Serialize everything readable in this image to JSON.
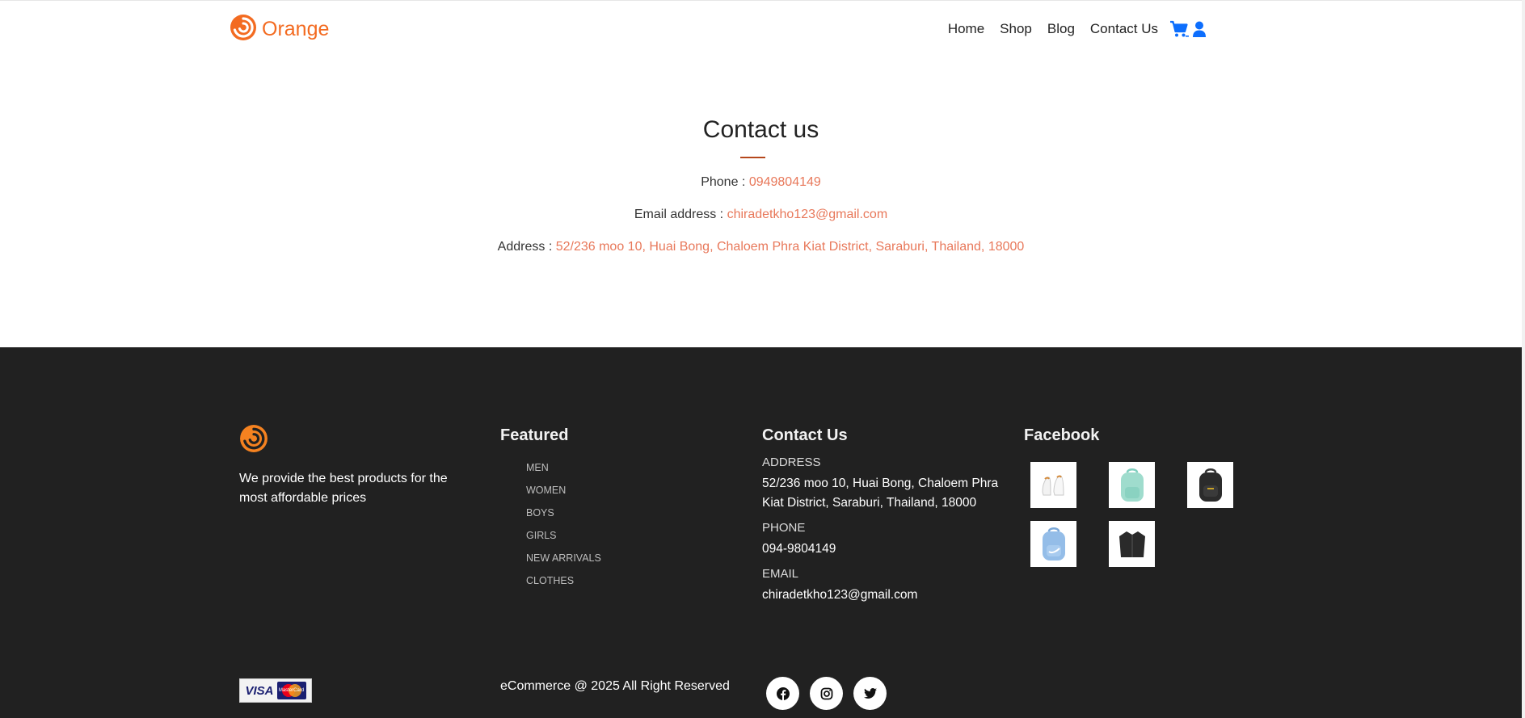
{
  "navbar": {
    "brand": "Orange",
    "links": [
      "Home",
      "Shop",
      "Blog",
      "Contact Us"
    ],
    "icons": [
      "cart-icon",
      "user-icon"
    ],
    "accent_color": "#f36b21",
    "icon_color": "#0d6efd"
  },
  "contact": {
    "title": "Contact us",
    "phone_label": "Phone :",
    "phone_value": "0949804149",
    "email_label": "Email address :",
    "email_value": "chiradetkho123@gmail.com",
    "address_label": "Address :",
    "address_value": "52/236 moo 10, Huai Bong, Chaloem Phra Kiat District, Saraburi, Thailand, 18000",
    "value_color": "#e8785a"
  },
  "footer": {
    "tagline": "We provide the best products for the most affordable prices",
    "featured": {
      "heading": "Featured",
      "items": [
        "MEN",
        "WOMEN",
        "BOYS",
        "GIRLS",
        "NEW ARRIVALS",
        "CLOTHES"
      ]
    },
    "contact_us": {
      "heading": "Contact Us",
      "address_label": "ADDRESS",
      "address_value": "52/236 moo 10, Huai Bong, Chaloem Phra Kiat District, Saraburi, Thailand, 18000",
      "phone_label": "PHONE",
      "phone_value": "094-9804149",
      "email_label": "EMAIL",
      "email_value": "chiradetkho123@gmail.com"
    },
    "facebook": {
      "heading": "Facebook",
      "thumbnails": [
        "white-sneakers",
        "mint-backpack",
        "black-backpack",
        "blue-backpack",
        "black-jacket"
      ]
    },
    "payment_badges": [
      "VISA",
      "MasterCard"
    ],
    "copyright": "eCommerce @ 2025 All Right Reserved",
    "socials": [
      "facebook-icon",
      "instagram-icon",
      "twitter-icon"
    ],
    "background": "#212121"
  }
}
